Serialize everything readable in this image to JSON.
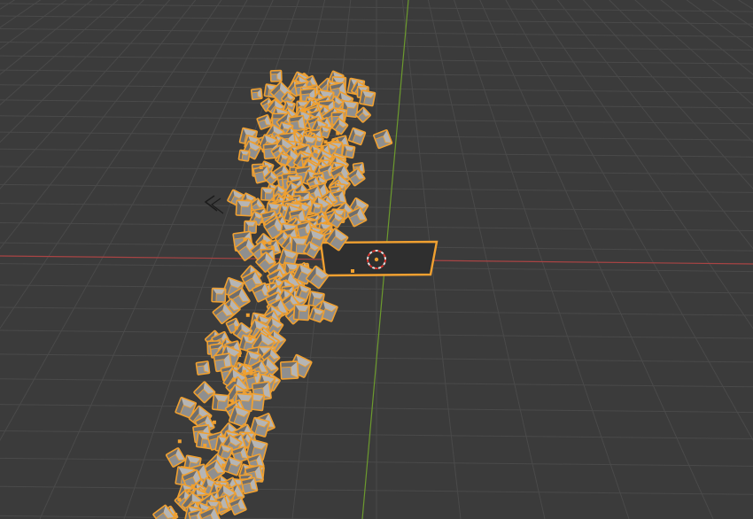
{
  "app": {
    "view": "3d-viewport",
    "background_color": "#3b3b3b"
  },
  "scene": {
    "grid": true,
    "grid_color": "#4a4a4a",
    "x_axis_color": "#a94444",
    "y_axis_color": "#6c9a2e",
    "selection_color": "#f0a030",
    "cube_face_color": "#8f8f8f",
    "cube_shade_color": "#6e6e6e",
    "cube_highlight_color": "#b5b5b5",
    "emitter_fill_color": "#2f2f2f",
    "cursor_color": "#e0e0e0",
    "cursor_accent_color": "#d9362f",
    "particle_count": 400,
    "objects": [
      {
        "name": "particle-system",
        "type": "particles",
        "selected": true
      },
      {
        "name": "emitter-plane",
        "type": "mesh",
        "selected": true
      },
      {
        "name": "3d-cursor",
        "type": "cursor"
      }
    ]
  }
}
